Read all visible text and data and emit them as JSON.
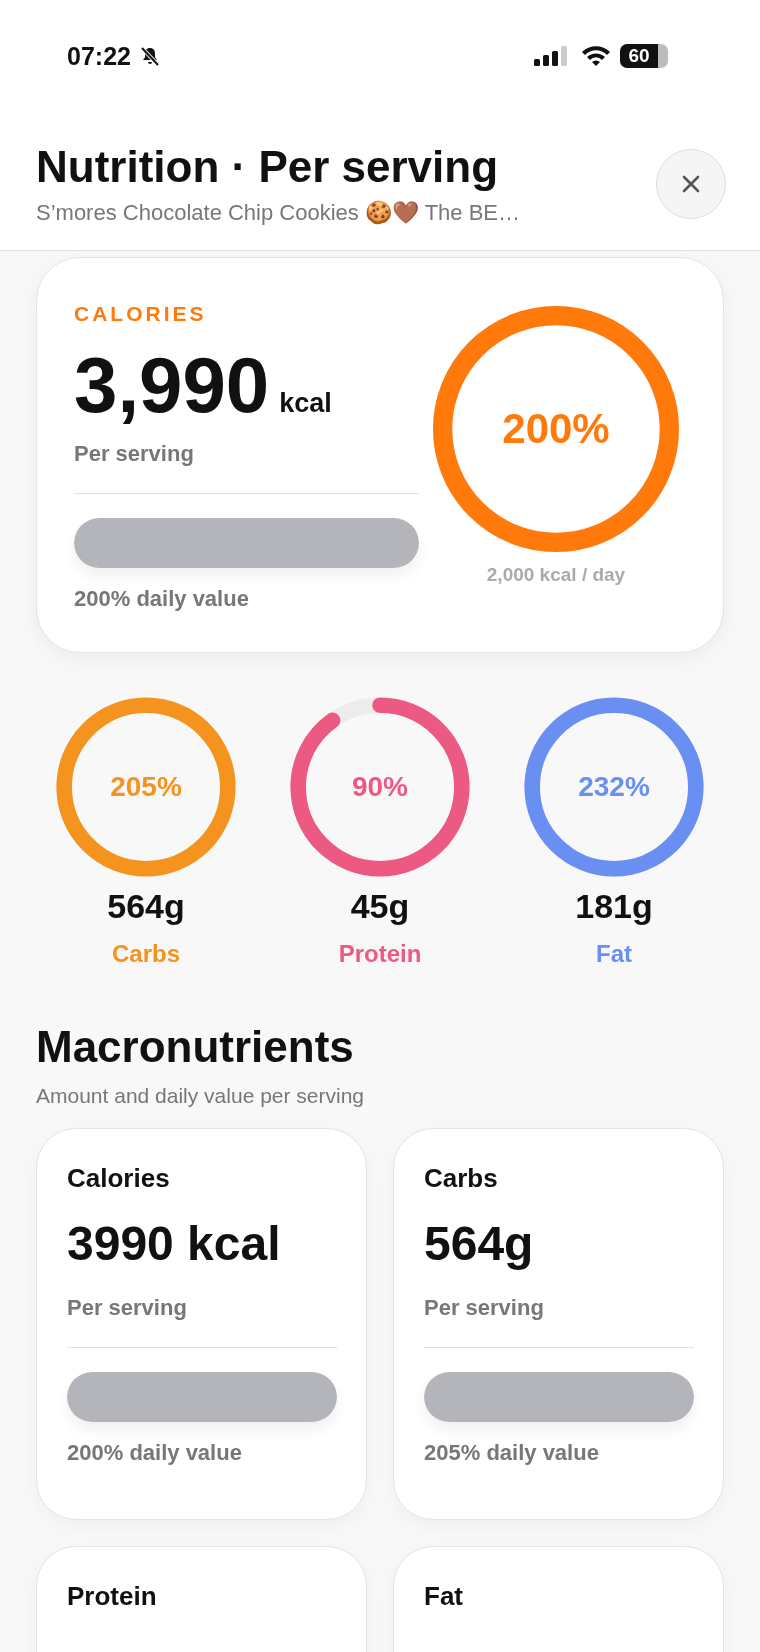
{
  "status_bar": {
    "time": "07:22",
    "battery": "60"
  },
  "header": {
    "title": "Nutrition · Per serving",
    "subtitle": "S’mores Chocolate Chip Cookies 🍪🤎 The BE…"
  },
  "calories_card": {
    "label": "CALORIES",
    "value": "3,990",
    "unit": "kcal",
    "caption": "Per serving",
    "level": 1,
    "daily_value": "200% daily value",
    "ring": {
      "level": 1,
      "percent": "200%",
      "goal": "2,000 kcal / day"
    }
  },
  "macro_rings": [
    {
      "percent": "205%",
      "amount": "564g",
      "name": "Carbs",
      "level": 1,
      "color": "#f4931e"
    },
    {
      "percent": "90%",
      "amount": "45g",
      "name": "Protein",
      "level": 0.9,
      "color": "#ec5a84"
    },
    {
      "percent": "232%",
      "amount": "181g",
      "name": "Fat",
      "level": 1,
      "color": "#6a8ff2"
    }
  ],
  "macronutrients": {
    "title": "Macronutrients",
    "subtitle": "Amount and daily value per serving",
    "cards": [
      {
        "name": "Calories",
        "value": "3990 kcal",
        "caption": "Per serving",
        "level": 1,
        "daily_value": "200% daily value"
      },
      {
        "name": "Carbs",
        "value": "564g",
        "caption": "Per serving",
        "level": 1,
        "daily_value": "205% daily value"
      },
      {
        "name": "Protein"
      },
      {
        "name": "Fat"
      }
    ]
  }
}
